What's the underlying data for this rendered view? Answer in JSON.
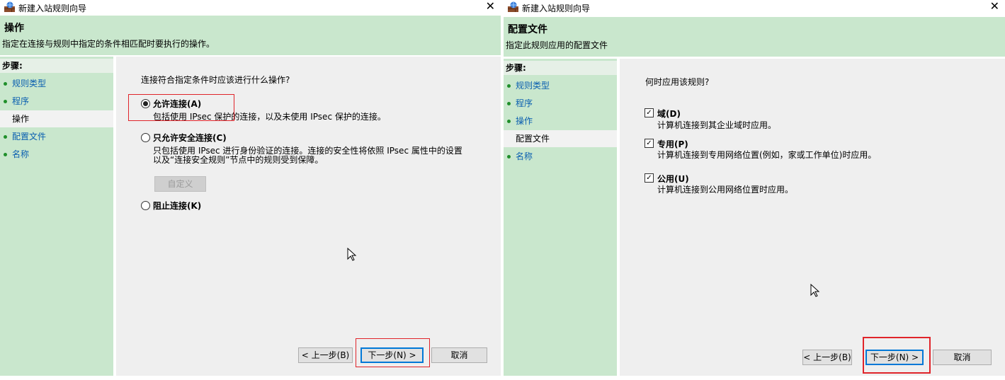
{
  "window1": {
    "title": "新建入站规则向导",
    "header_title": "操作",
    "header_subtitle": "指定在连接与规则中指定的条件相匹配时要执行的操作。",
    "steps_label": "步骤:",
    "steps": [
      "规则类型",
      "程序",
      "操作",
      "配置文件",
      "名称"
    ],
    "active_step": "操作",
    "question": "连接符合指定条件时应该进行什么操作?",
    "options": [
      {
        "label": "允许连接(A)",
        "desc": "包括使用 IPsec 保护的连接，以及未使用 IPsec 保护的连接。",
        "selected": true
      },
      {
        "label": "只允许安全连接(C)",
        "desc": "只包括使用 IPsec 进行身份验证的连接。连接的安全性将依照 IPsec 属性中的设置以及“连接安全规则”节点中的规则受到保障。",
        "selected": false
      },
      {
        "label": "阻止连接(K)",
        "desc": "",
        "selected": false
      }
    ],
    "customize_label": "自定义",
    "back_label": "< 上一步(B)",
    "next_label": "下一步(N) >",
    "cancel_label": "取消"
  },
  "window2": {
    "title": "新建入站规则向导",
    "header_title": "配置文件",
    "header_subtitle": "指定此规则应用的配置文件",
    "steps_label": "步骤:",
    "steps": [
      "规则类型",
      "程序",
      "操作",
      "配置文件",
      "名称"
    ],
    "active_step": "配置文件",
    "question": "何时应用该规则?",
    "profiles": [
      {
        "label": "域(D)",
        "desc": "计算机连接到其企业域时应用。",
        "checked": true
      },
      {
        "label": "专用(P)",
        "desc": "计算机连接到专用网络位置(例如，家或工作单位)时应用。",
        "checked": true
      },
      {
        "label": "公用(U)",
        "desc": "计算机连接到公用网络位置时应用。",
        "checked": true
      }
    ],
    "back_label": "< 上一步(B)",
    "next_label": "下一步(N) >",
    "cancel_label": "取消"
  },
  "colors": {
    "panel_green": "#c9e7cd",
    "highlight_red": "#e0242a",
    "link_blue": "#0a5fb0"
  }
}
